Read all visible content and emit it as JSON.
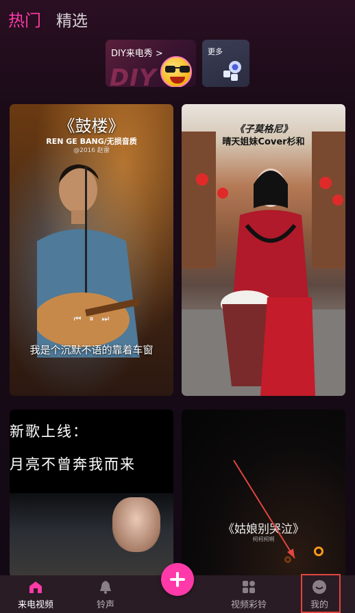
{
  "top_tabs": [
    {
      "label": "热门",
      "active": true
    },
    {
      "label": "精选",
      "active": false
    }
  ],
  "banners": {
    "diy": {
      "title": "DIY来电秀 >",
      "watermark": "DIY"
    },
    "more": {
      "title": "更多"
    }
  },
  "videos": [
    {
      "headline": "《鼓楼》",
      "line1": "REN GE BANG/无损音质",
      "line2": "@2016 赵雷",
      "caption": "我是个沉默不语的靠着车窗"
    },
    {
      "headline": "《子莫格尼》",
      "subtitle": "晴天姐妹Cover杉和"
    },
    {
      "line1": "新歌上线：",
      "line2": "月亮不曾奔我而来"
    },
    {
      "caption": "《姑娘别哭泣》",
      "subtitle": "柯柯柯啊"
    }
  ],
  "bottom_nav": [
    {
      "label": "来电视频",
      "icon": "home-icon",
      "active": true
    },
    {
      "label": "铃声",
      "icon": "bell-icon",
      "active": false
    },
    {
      "label": "视频彩铃",
      "icon": "grid-icon",
      "active": false
    },
    {
      "label": "我的",
      "icon": "smiley-icon",
      "active": false
    }
  ],
  "colors": {
    "accent": "#ff3aa8",
    "annotation": "#e2463f",
    "nav_bg": "#2a1c25"
  }
}
